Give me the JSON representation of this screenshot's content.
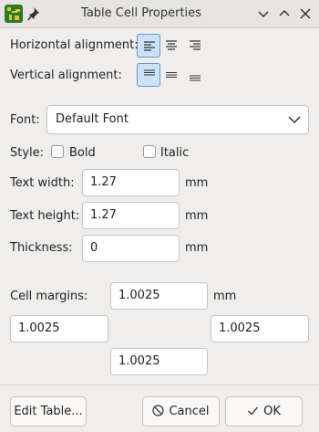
{
  "window": {
    "title": "Table Cell Properties"
  },
  "alignment": {
    "horizontal_label": "Horizontal alignment:",
    "vertical_label": "Vertical alignment:"
  },
  "font": {
    "label": "Font:",
    "value": "Default Font"
  },
  "style": {
    "label": "Style:",
    "bold_label": "Bold",
    "italic_label": "Italic",
    "bold_checked": false,
    "italic_checked": false
  },
  "text_width": {
    "label": "Text width:",
    "value": "1.27",
    "unit": "mm"
  },
  "text_height": {
    "label": "Text height:",
    "value": "1.27",
    "unit": "mm"
  },
  "thickness": {
    "label": "Thickness:",
    "value": "0",
    "unit": "mm"
  },
  "margins": {
    "label": "Cell margins:",
    "top": "1.0025",
    "left": "1.0025",
    "right": "1.0025",
    "bottom": "1.0025",
    "unit": "mm"
  },
  "buttons": {
    "edit_table": "Edit Table...",
    "cancel": "Cancel",
    "ok": "OK"
  },
  "colors": {
    "selected_bg": "#cce2f6",
    "selected_border": "#5a9bd8"
  },
  "icons": [
    "app-icon",
    "pin-icon",
    "minimize-icon",
    "maximize-icon",
    "close-icon",
    "chevron-down-icon",
    "cancel-icon",
    "check-icon"
  ]
}
